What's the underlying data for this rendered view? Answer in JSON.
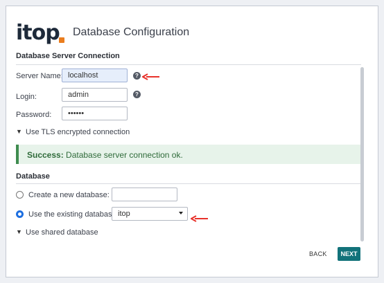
{
  "brand": {
    "logo_text": "itop"
  },
  "page_title": "Database Configuration",
  "server_section": {
    "title": "Database Server Connection",
    "server_name_label": "Server Name:",
    "server_name_value": "localhost",
    "login_label": "Login:",
    "login_value": "admin",
    "password_label": "Password:",
    "password_value": "••••••",
    "tls_toggle": "Use TLS encrypted connection"
  },
  "alert": {
    "strong": "Success:",
    "message": " Database server connection ok."
  },
  "database_section": {
    "title": "Database",
    "create_label": "Create a new database:",
    "create_value": "",
    "use_existing_label": "Use the existing database:",
    "existing_selected": "itop",
    "shared_toggle": "Use shared database"
  },
  "footer": {
    "back": "BACK",
    "next": "NEXT"
  },
  "colors": {
    "accent": "#12727a",
    "logo_dot": "#ea7d1e",
    "arrow": "#e8312a",
    "success_border": "#3f8c4f"
  },
  "icons": [
    "help-icon",
    "chevron-down-icon",
    "red-arrow-annotation"
  ]
}
